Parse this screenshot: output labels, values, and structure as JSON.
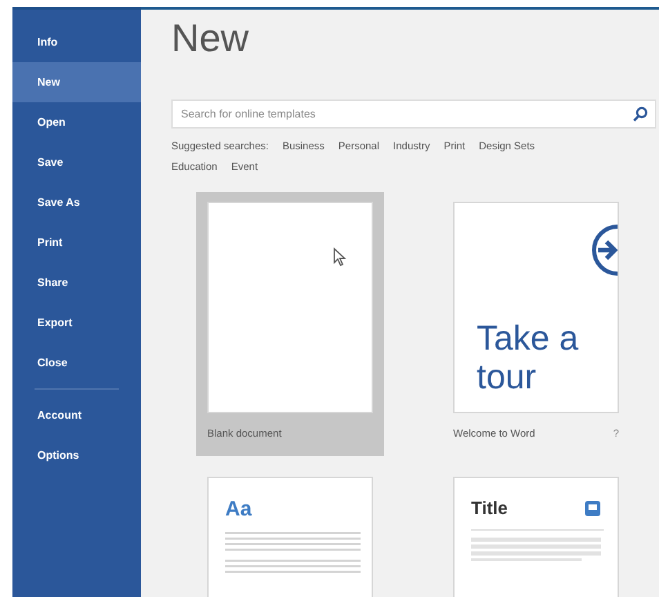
{
  "sidebar": {
    "items": [
      {
        "label": "Info",
        "selected": false
      },
      {
        "label": "New",
        "selected": true
      },
      {
        "label": "Open",
        "selected": false
      },
      {
        "label": "Save",
        "selected": false
      },
      {
        "label": "Save As",
        "selected": false
      },
      {
        "label": "Print",
        "selected": false
      },
      {
        "label": "Share",
        "selected": false
      },
      {
        "label": "Export",
        "selected": false
      },
      {
        "label": "Close",
        "selected": false
      },
      {
        "label": "Account",
        "selected": false,
        "divider_before": true
      },
      {
        "label": "Options",
        "selected": false
      }
    ]
  },
  "title": "New",
  "search": {
    "placeholder": "Search for online templates"
  },
  "suggested": {
    "label": "Suggested searches:",
    "links": [
      "Business",
      "Personal",
      "Industry",
      "Print",
      "Design Sets",
      "Education",
      "Event"
    ]
  },
  "templates": [
    {
      "kind": "blank",
      "label": "Blank document",
      "selected": true
    },
    {
      "kind": "tour",
      "heading": "Take a tour",
      "label": "Welcome to Word",
      "pin": "?",
      "selected": false
    },
    {
      "kind": "aa",
      "heading": "Aa",
      "selected": false
    },
    {
      "kind": "title",
      "heading": "Title",
      "selected": false
    }
  ]
}
